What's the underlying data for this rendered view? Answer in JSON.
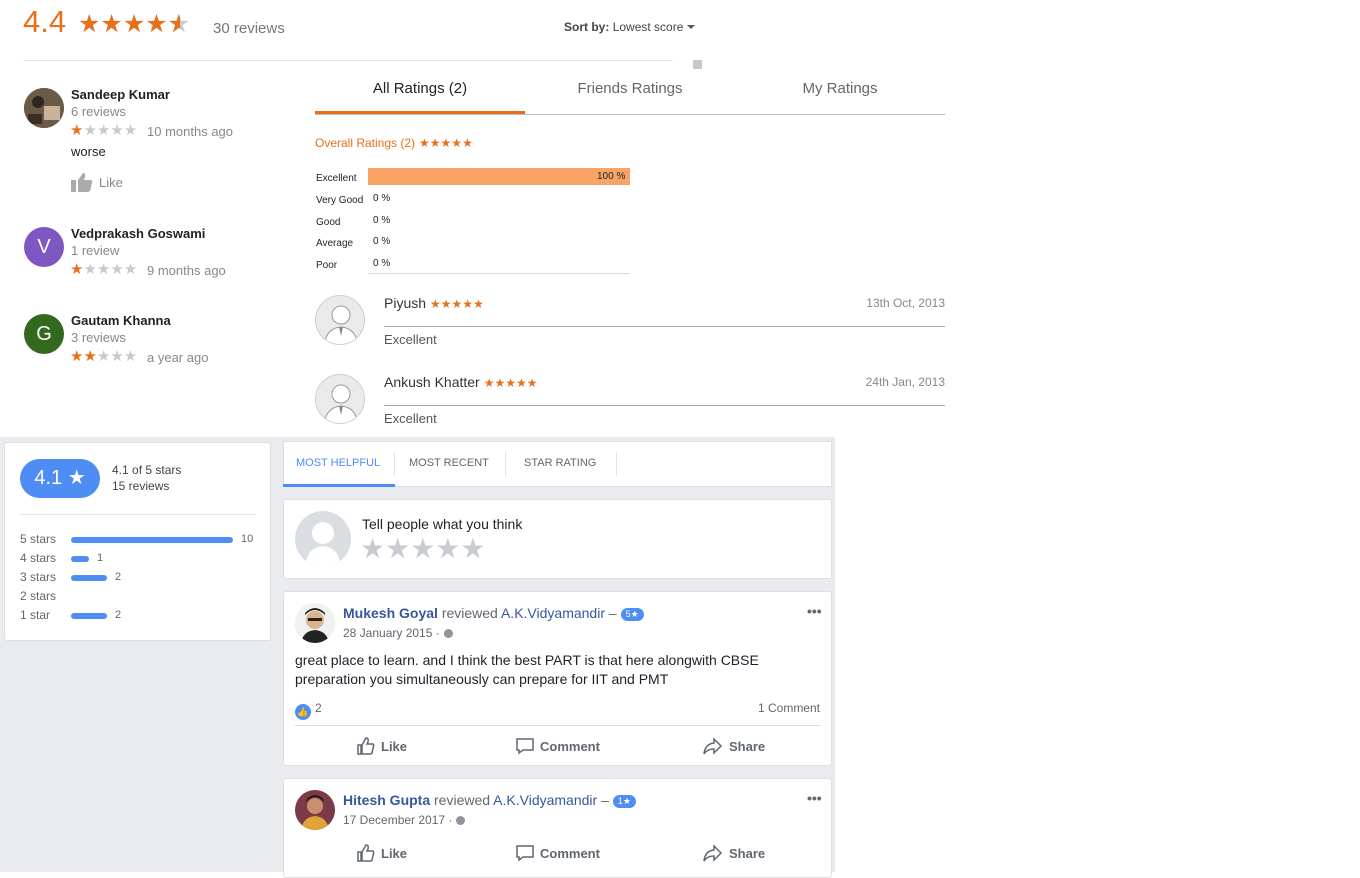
{
  "google": {
    "score": "4.4",
    "stars": "★★★★★",
    "count": "30 reviews",
    "sort_label": "Sort by:",
    "sort_value": "Lowest score",
    "reviews": [
      {
        "name": "Sandeep Kumar",
        "sub": "6 reviews",
        "rating": 1,
        "time": "10 months ago",
        "text": "worse",
        "like": "Like",
        "avatar_color": "#5a4a3a"
      },
      {
        "name": "Vedprakash Goswami",
        "sub": "1 review",
        "rating": 1,
        "time": "9 months ago",
        "initial": "V",
        "avatar_color": "#7e57c2"
      },
      {
        "name": "Gautam Khanna",
        "sub": "3 reviews",
        "rating": 2,
        "time": "a year ago",
        "initial": "G",
        "avatar_color": "#33691e"
      }
    ],
    "colors": {
      "accent": "#e7711b"
    }
  },
  "widget": {
    "tabs": [
      "All Ratings (2)",
      "Friends Ratings",
      "My Ratings"
    ],
    "overall": "Overall Ratings (2)",
    "overall_stars": "★★★★★",
    "distribution": [
      {
        "label": "Excellent",
        "value": "100 %",
        "fraction": 1.0
      },
      {
        "label": "Very Good",
        "value": "0 %",
        "fraction": 0
      },
      {
        "label": "Good",
        "value": "0 %",
        "fraction": 0
      },
      {
        "label": "Average",
        "value": "0 %",
        "fraction": 0
      },
      {
        "label": "Poor",
        "value": "0 %",
        "fraction": 0
      }
    ],
    "reviews": [
      {
        "name": "Piyush",
        "stars": "★★★★★",
        "date": "13th Oct, 2013",
        "text": "Excellent"
      },
      {
        "name": "Ankush Khatter",
        "stars": "★★★★★",
        "date": "24th Jan, 2013",
        "text": "Excellent"
      }
    ]
  },
  "fb": {
    "summary": {
      "score": "4.1 ★",
      "of_text": "4.1 of 5 stars",
      "count": "15 reviews",
      "rows": [
        {
          "label": "5 stars",
          "count": "10",
          "value": 10
        },
        {
          "label": "4 stars",
          "count": "1",
          "value": 1
        },
        {
          "label": "3 stars",
          "count": "2",
          "value": 2
        },
        {
          "label": "2 stars",
          "count": "",
          "value": 0
        },
        {
          "label": "1 star",
          "count": "2",
          "value": 2
        }
      ]
    },
    "tabs": [
      "MOST HELPFUL",
      "MOST RECENT",
      "STAR RATING"
    ],
    "write": {
      "prompt": "Tell people what you think",
      "stars": "★★★★★"
    },
    "posts": [
      {
        "name": "Mukesh Goyal",
        "verb": "reviewed",
        "page": "A.K.Vidyamandir",
        "dash": "–",
        "badge": "5★",
        "date": "28 January 2015 ·",
        "body": "great place to learn. and I think the best PART is that here alongwith CBSE preparation you simultaneously can prepare for IIT and PMT",
        "likes": "2",
        "comments": "1 Comment"
      },
      {
        "name": "Hitesh Gupta",
        "verb": "reviewed",
        "page": "A.K.Vidyamandir",
        "dash": "–",
        "badge": "1★",
        "date": "17 December 2017 ·"
      }
    ],
    "actions": {
      "like": "Like",
      "comment": "Comment",
      "share": "Share"
    },
    "more": "•••",
    "colors": {
      "accent": "#4e8df4",
      "link": "#365899"
    }
  }
}
